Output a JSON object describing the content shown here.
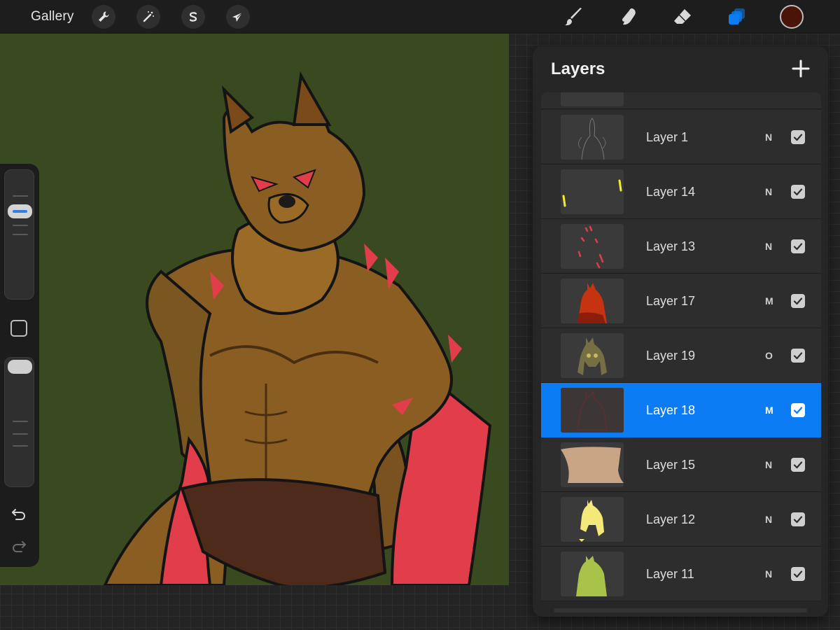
{
  "toolbar": {
    "gallery_label": "Gallery",
    "actions": [
      {
        "name": "actions-button",
        "icon": "wrench-icon"
      },
      {
        "name": "adjustments-button",
        "icon": "magic-wand-icon"
      },
      {
        "name": "selection-button",
        "icon": "selection-s-icon"
      },
      {
        "name": "transform-button",
        "icon": "arrow-cursor-icon"
      }
    ],
    "tools": [
      {
        "name": "brush-tool",
        "icon": "brush-icon"
      },
      {
        "name": "smudge-tool",
        "icon": "smudge-icon"
      },
      {
        "name": "eraser-tool",
        "icon": "eraser-icon"
      },
      {
        "name": "layers-tool",
        "icon": "layers-icon",
        "active": true
      }
    ],
    "current_color": "#4a1408",
    "accent_color": "#0b7cf4"
  },
  "canvas": {
    "background_color": "#3a4a20"
  },
  "sidebar": {
    "brush_size_icon": "brush-size-slider",
    "modify_icon": "eyedropper-square-icon",
    "opacity_icon": "opacity-slider",
    "undo_icon": "undo-arrow-icon",
    "redo_icon": "redo-arrow-icon"
  },
  "layers_panel": {
    "title": "Layers",
    "add_icon": "plus-icon",
    "layers": [
      {
        "name": "Layer 1",
        "mode": "N",
        "visible": true,
        "selected": false
      },
      {
        "name": "Layer 14",
        "mode": "N",
        "visible": true,
        "selected": false
      },
      {
        "name": "Layer 13",
        "mode": "N",
        "visible": true,
        "selected": false
      },
      {
        "name": "Layer 17",
        "mode": "M",
        "visible": true,
        "selected": false
      },
      {
        "name": "Layer 19",
        "mode": "O",
        "visible": true,
        "selected": false
      },
      {
        "name": "Layer 18",
        "mode": "M",
        "visible": true,
        "selected": true
      },
      {
        "name": "Layer 15",
        "mode": "N",
        "visible": true,
        "selected": false
      },
      {
        "name": "Layer 12",
        "mode": "N",
        "visible": true,
        "selected": false
      },
      {
        "name": "Layer 11",
        "mode": "N",
        "visible": true,
        "selected": false
      }
    ]
  }
}
